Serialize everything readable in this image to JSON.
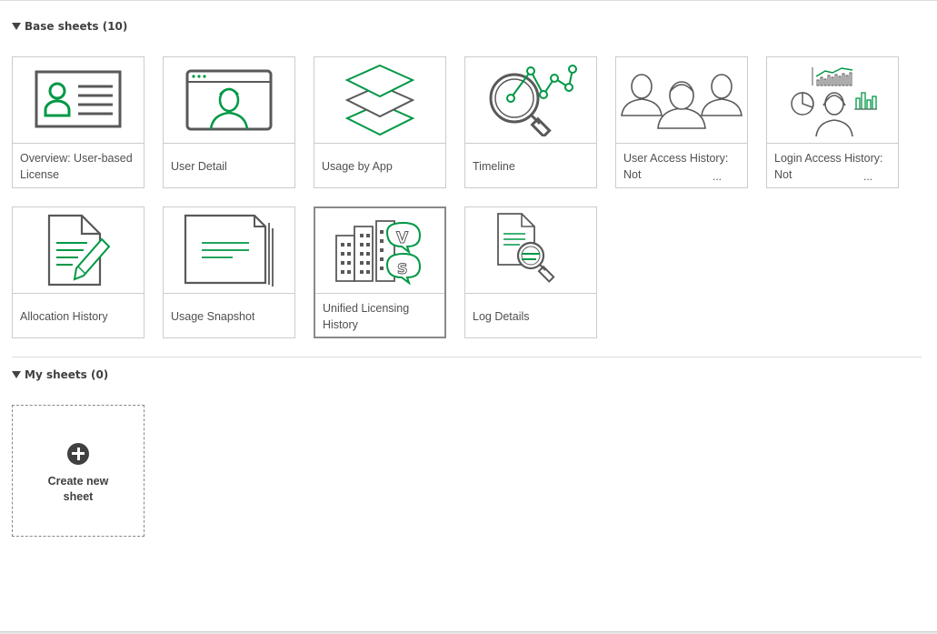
{
  "base_sheets": {
    "title": "Base sheets (10)",
    "items": [
      {
        "label": "Overview: User-based License",
        "ellipsis": ""
      },
      {
        "label": "User Detail",
        "ellipsis": ""
      },
      {
        "label": "Usage by App",
        "ellipsis": ""
      },
      {
        "label": "Timeline",
        "ellipsis": ""
      },
      {
        "label": "User Access History: Not",
        "ellipsis": "..."
      },
      {
        "label": "Login Access History: Not",
        "ellipsis": "..."
      },
      {
        "label": "Allocation History",
        "ellipsis": ""
      },
      {
        "label": "Usage Snapshot",
        "ellipsis": ""
      },
      {
        "label": "Unified Licensing History",
        "ellipsis": ""
      },
      {
        "label": "Log Details",
        "ellipsis": ""
      }
    ]
  },
  "my_sheets": {
    "title": "My sheets (0)",
    "create_label": "Create new sheet"
  },
  "colors": {
    "accent": "#009845",
    "icon_gray": "#595959"
  }
}
